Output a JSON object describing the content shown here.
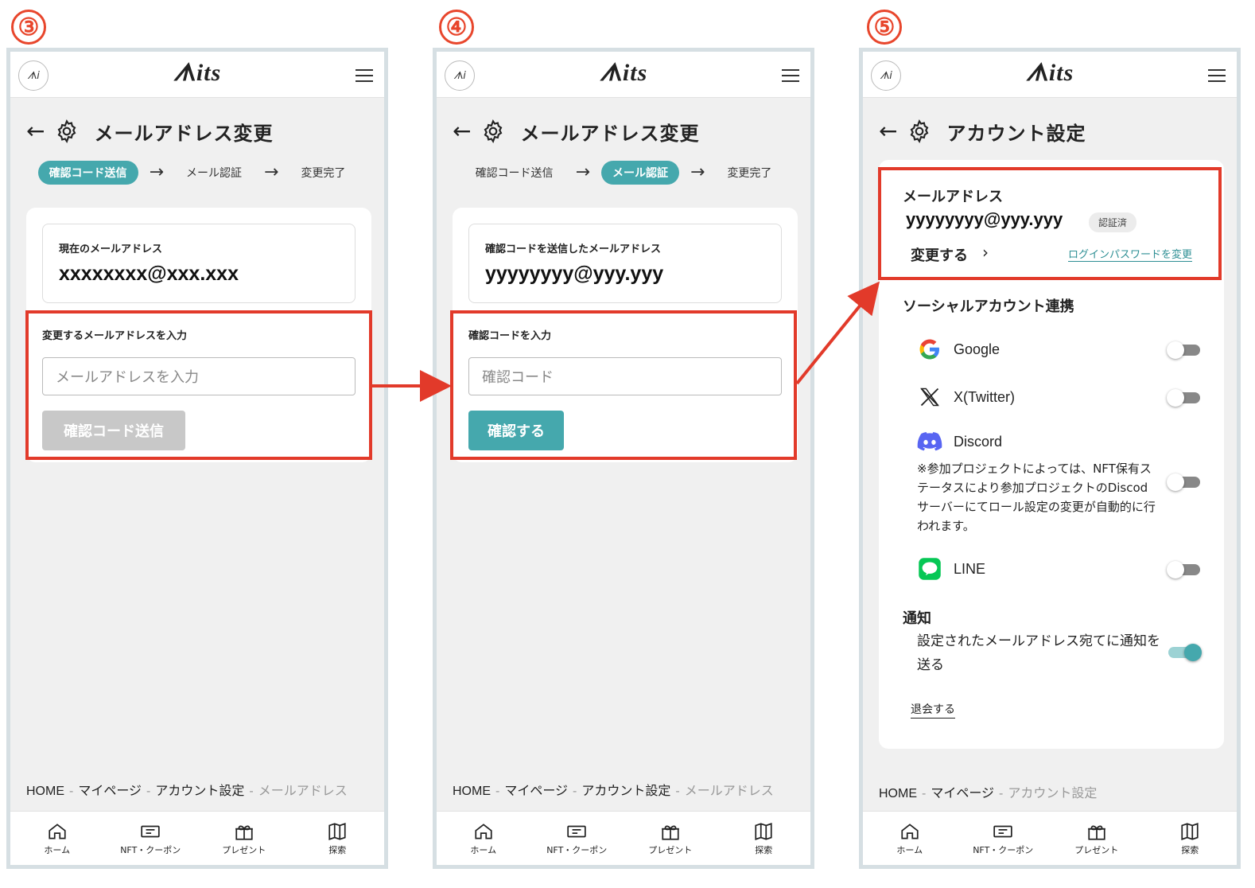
{
  "app": {
    "logo_badge": "ᗑi",
    "logo_text": "ᗑits"
  },
  "step_numbers": [
    "③",
    "④",
    "⑤"
  ],
  "common": {
    "back_icon": "←",
    "email_change_title": "メールアドレス変更",
    "steps": [
      "確認コード送信",
      "メール認証",
      "変更完了"
    ],
    "step_arrow": "→",
    "breadcrumb_home": "HOME",
    "breadcrumb_mypage": "マイページ",
    "breadcrumb_account": "アカウント設定",
    "breadcrumb_email": "メールアドレス",
    "breadcrumb_sep": "-",
    "nav": [
      "ホーム",
      "NFT・クーポン",
      "プレゼント",
      "探索"
    ]
  },
  "screen3": {
    "current_email_label": "現在のメールアドレス",
    "current_email": "xxxxxxxx@xxx.xxx",
    "new_email_label": "変更するメールアドレスを入力",
    "new_email_placeholder": "メールアドレスを入力",
    "send_button": "確認コード送信"
  },
  "screen4": {
    "sent_email_label": "確認コードを送信したメールアドレス",
    "sent_email": "yyyyyyyy@yyy.yyy",
    "code_label": "確認コードを入力",
    "code_placeholder": "確認コード",
    "verify_button": "確認する"
  },
  "screen5": {
    "title": "アカウント設定",
    "email_section": "メールアドレス",
    "email": "yyyyyyyy@yyy.yyy",
    "verified_badge": "認証済",
    "change_link": "変更する",
    "chevron": "›",
    "password_link": "ログインパスワードを変更",
    "social_section": "ソーシャルアカウント連携",
    "social": [
      {
        "name": "Google",
        "on": false
      },
      {
        "name": "X(Twitter)",
        "on": false
      },
      {
        "name": "Discord",
        "on": false
      },
      {
        "name": "LINE",
        "on": false
      }
    ],
    "discord_note": "※参加プロジェクトによっては、NFT保有ステータスにより参加プロジェクトのDiscodサーバーにてロール設定の変更が自動的に行われます。",
    "notify_section": "通知",
    "notify_desc": "設定されたメールアドレス宛てに通知を送る",
    "notify_on": true,
    "withdraw_link": "退会する"
  },
  "colors": {
    "accent": "#45a8ad",
    "highlight": "#e23a2a",
    "step_number": "#e8462c"
  }
}
